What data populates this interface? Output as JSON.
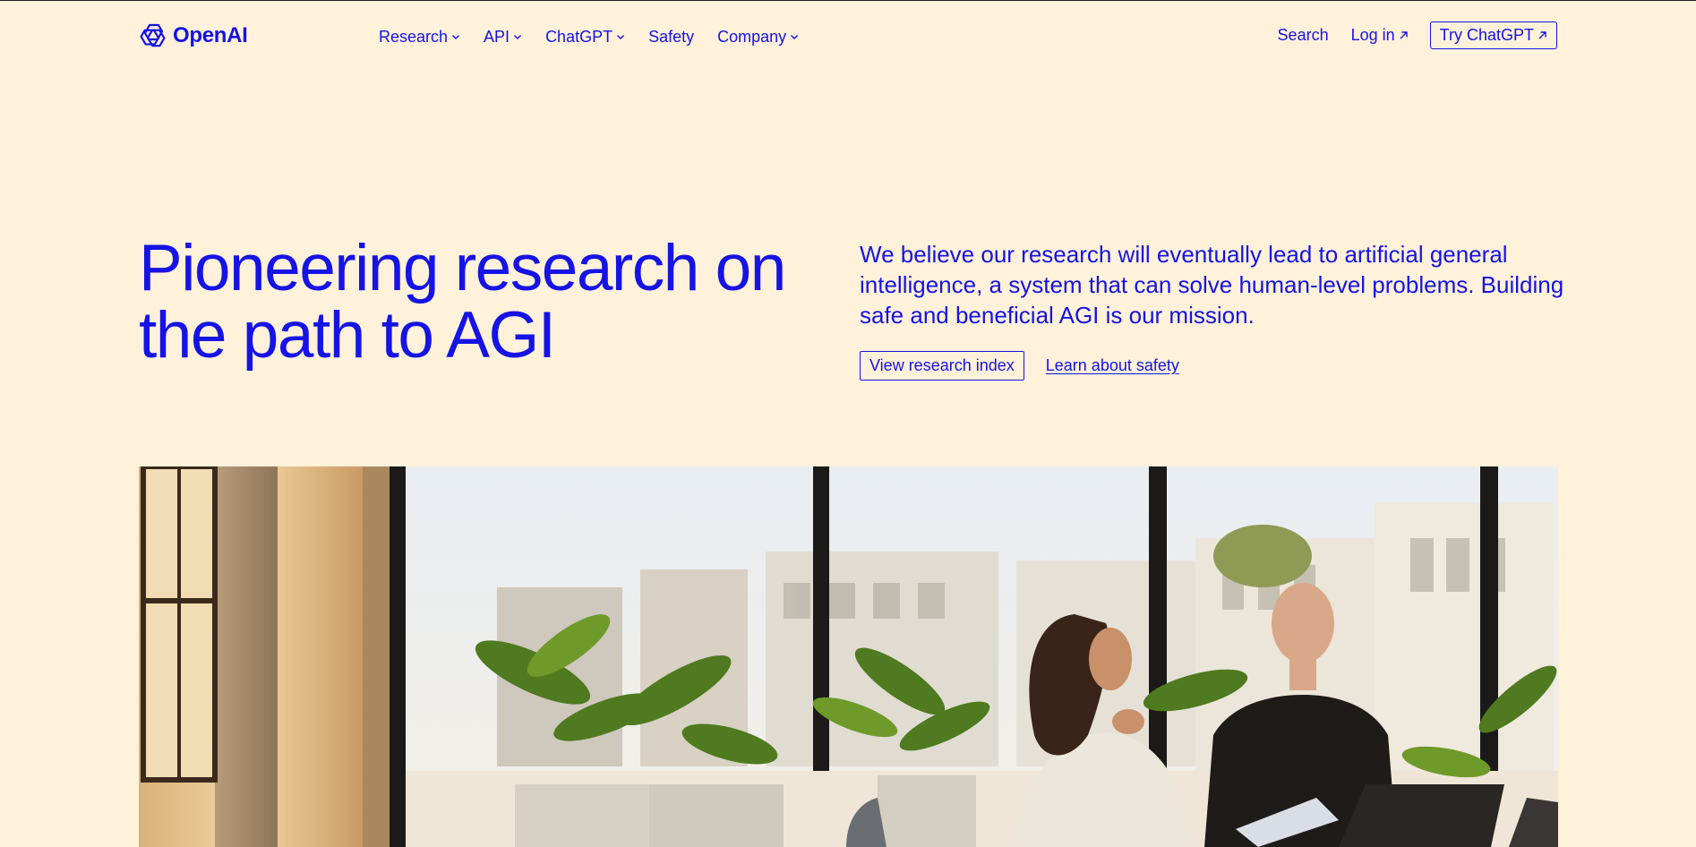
{
  "header": {
    "logo_text": "OpenAI",
    "nav": [
      {
        "label": "Research",
        "has_dropdown": true
      },
      {
        "label": "API",
        "has_dropdown": true
      },
      {
        "label": "ChatGPT",
        "has_dropdown": true
      },
      {
        "label": "Safety",
        "has_dropdown": false
      },
      {
        "label": "Company",
        "has_dropdown": true
      }
    ],
    "search_label": "Search",
    "login_label": "Log in",
    "try_label": "Try ChatGPT"
  },
  "hero": {
    "title": "Pioneering research on the path to AGI",
    "description": "We believe our research will eventually lead to artificial general intelligence, a system that can solve human-level problems. Building safe and beneficial AGI is our mission.",
    "cta_primary": "View research index",
    "cta_secondary": "Learn about safety"
  },
  "colors": {
    "background": "#fff1da",
    "brand_blue": "#1513e6"
  },
  "icons": {
    "logo": "openai-logo-icon",
    "dropdown": "chevron-down-icon",
    "external": "arrow-up-right-icon"
  }
}
